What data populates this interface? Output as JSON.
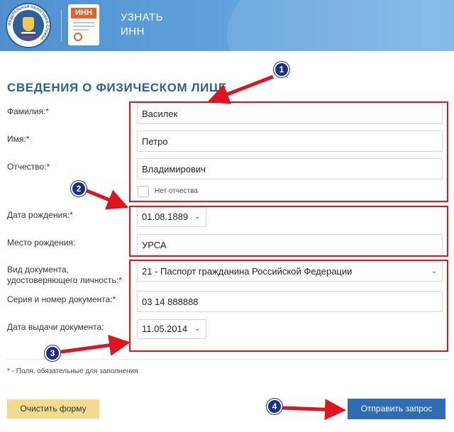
{
  "header": {
    "logo_text": "ФЕДЕРАЛЬНАЯ НАЛОГОВАЯ СЛУЖБА",
    "icon_badge": "ИНН",
    "title_line1": "УЗНАТЬ",
    "title_line2": "ИНН"
  },
  "form": {
    "section_title": "СВЕДЕНИЯ О ФИЗИЧЕСКОМ ЛИЦЕ",
    "required_mark": "*",
    "surname": {
      "label": "Фамилия:",
      "value": "Василек"
    },
    "name": {
      "label": "Имя:",
      "value": "Петро"
    },
    "patronymic": {
      "label": "Отчество:",
      "value": "Владимирович"
    },
    "no_patronymic_label": "Нет отчества",
    "birth_date": {
      "label": "Дата рождения:",
      "value": "01.08.1889"
    },
    "birth_place": {
      "label": "Место рождения:",
      "value": "УРСА"
    },
    "doc_type": {
      "label_line1": "Вид документа,",
      "label_line2": "удостоверяющего личность:",
      "value": "21 - Паспорт гражданина Российской Федерации"
    },
    "doc_number": {
      "label": "Серия и номер документа:",
      "value": "03 14 888888"
    },
    "doc_date": {
      "label": "Дата выдачи документа:",
      "value": "11.05.2014"
    },
    "required_note": "- Поля, обязательные для заполнения"
  },
  "buttons": {
    "clear": "Очистить форму",
    "submit": "Отправить запрос"
  },
  "annotations": [
    "1",
    "2",
    "3",
    "4"
  ],
  "colors": {
    "header_blue": "#5fa0dc",
    "title_blue": "#2a5f9e",
    "highlight_red": "#e0141e",
    "marker_navy": "#1b2f8a",
    "clear_button": "#f2dc8c",
    "submit_button": "#2e6db4"
  }
}
